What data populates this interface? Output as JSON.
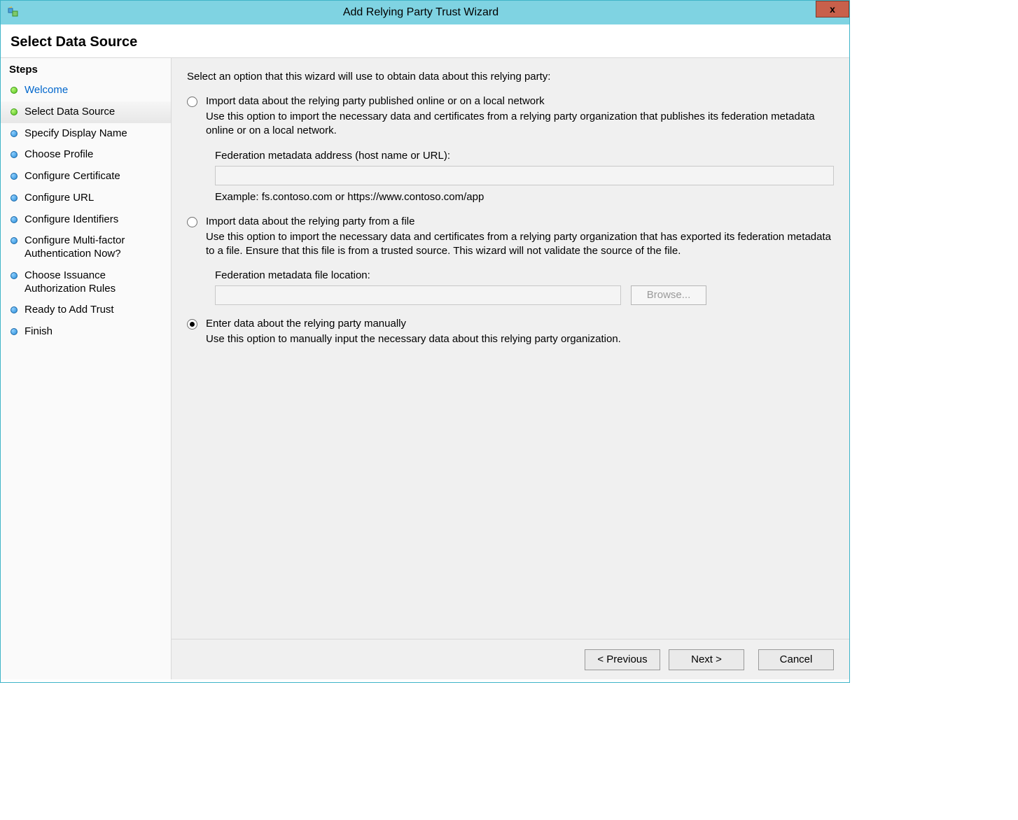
{
  "window": {
    "title": "Add Relying Party Trust Wizard",
    "close_label": "x"
  },
  "page": {
    "title": "Select Data Source"
  },
  "sidebar": {
    "header": "Steps",
    "items": [
      {
        "label": "Welcome"
      },
      {
        "label": "Select Data Source"
      },
      {
        "label": "Specify Display Name"
      },
      {
        "label": "Choose Profile"
      },
      {
        "label": "Configure Certificate"
      },
      {
        "label": "Configure URL"
      },
      {
        "label": "Configure Identifiers"
      },
      {
        "label": "Configure Multi-factor Authentication Now?"
      },
      {
        "label": "Choose Issuance Authorization Rules"
      },
      {
        "label": "Ready to Add Trust"
      },
      {
        "label": "Finish"
      }
    ]
  },
  "main": {
    "intro": "Select an option that this wizard will use to obtain data about this relying party:",
    "option1": {
      "label": "Import data about the relying party published online or on a local network",
      "desc": "Use this option to import the necessary data and certificates from a relying party organization that publishes its federation metadata online or on a local network.",
      "field_label": "Federation metadata address (host name or URL):",
      "example": "Example: fs.contoso.com or https://www.contoso.com/app"
    },
    "option2": {
      "label": "Import data about the relying party from a file",
      "desc": "Use this option to import the necessary data and certificates from a relying party organization that has exported its federation metadata to a file. Ensure that this file is from a trusted source.  This wizard will not validate the source of the file.",
      "field_label": "Federation metadata file location:",
      "browse": "Browse..."
    },
    "option3": {
      "label": "Enter data about the relying party manually",
      "desc": "Use this option to manually input the necessary data about this relying party organization."
    }
  },
  "footer": {
    "previous": "< Previous",
    "next": "Next >",
    "cancel": "Cancel"
  }
}
